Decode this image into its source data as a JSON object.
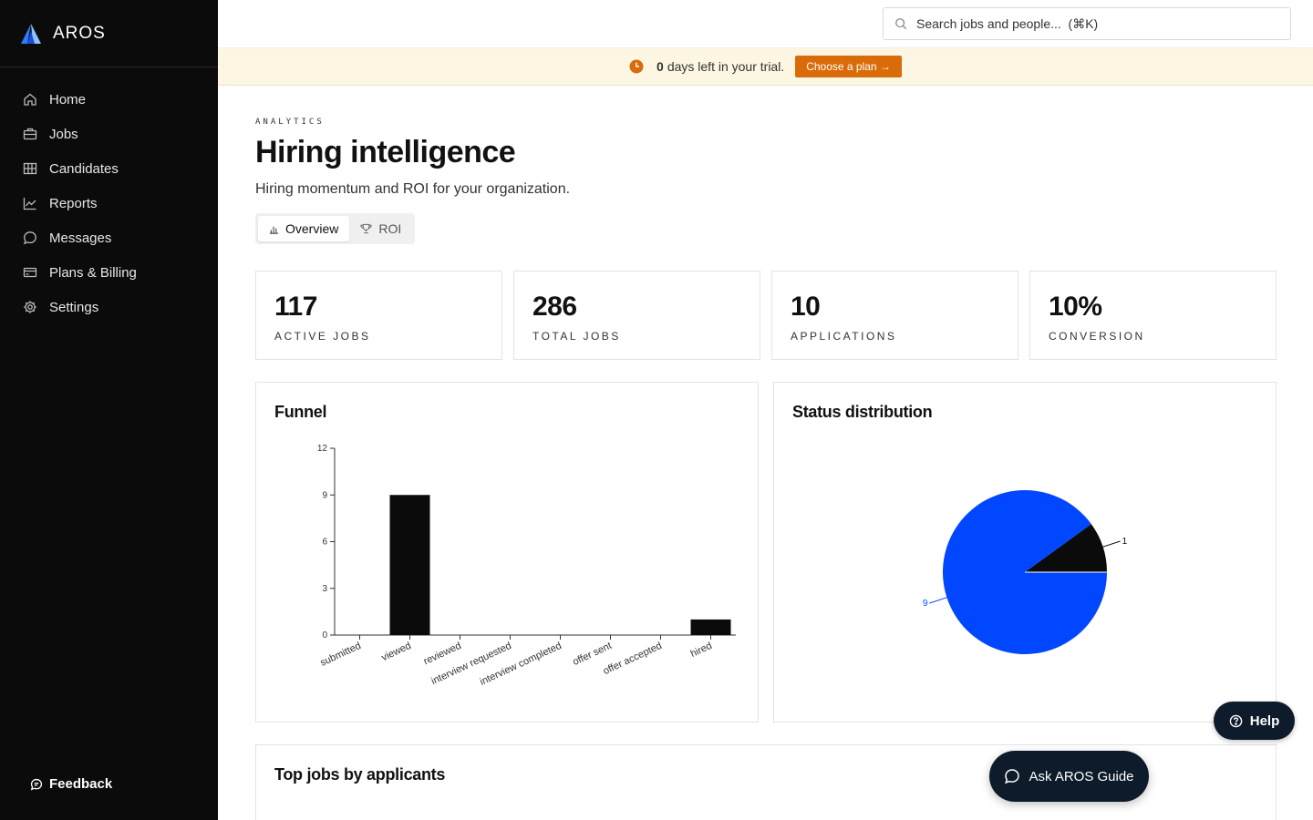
{
  "app": {
    "name": "AROS"
  },
  "sidebar": {
    "items": [
      {
        "label": "Home",
        "icon": "home-icon"
      },
      {
        "label": "Jobs",
        "icon": "briefcase-icon"
      },
      {
        "label": "Candidates",
        "icon": "candidates-icon"
      },
      {
        "label": "Reports",
        "icon": "chart-icon"
      },
      {
        "label": "Messages",
        "icon": "message-icon"
      },
      {
        "label": "Plans & Billing",
        "icon": "credit-card-icon"
      },
      {
        "label": "Settings",
        "icon": "gear-icon"
      }
    ],
    "feedback_label": "Feedback"
  },
  "search": {
    "placeholder": "Search jobs and people...  (⌘K)"
  },
  "trial": {
    "days": "0",
    "text": "days left in your trial.",
    "button": "Choose a plan →"
  },
  "page": {
    "eyebrow": "ANALYTICS",
    "title": "Hiring intelligence",
    "subtitle": "Hiring momentum and ROI for your organization.",
    "tabs": [
      {
        "label": "Overview"
      },
      {
        "label": "ROI"
      }
    ]
  },
  "kpis": [
    {
      "value": "117",
      "label": "ACTIVE JOBS"
    },
    {
      "value": "286",
      "label": "TOTAL JOBS"
    },
    {
      "value": "10",
      "label": "APPLICATIONS"
    },
    {
      "value": "10%",
      "label": "CONVERSION"
    }
  ],
  "cards": {
    "funnel_title": "Funnel",
    "status_title": "Status distribution",
    "top_jobs_title": "Top jobs by applicants"
  },
  "colors": {
    "accent": "#d96c09",
    "pie_primary": "#0047ff",
    "bar": "#0b0b0b",
    "dark_button": "#0d1b2a"
  },
  "chart_data": [
    {
      "type": "bar",
      "categories": [
        "submitted",
        "viewed",
        "reviewed",
        "interview requested",
        "interview completed",
        "offer sent",
        "offer accepted",
        "hired"
      ],
      "values": [
        0,
        9,
        0,
        0,
        0,
        0,
        0,
        1
      ],
      "yticks": [
        "0",
        "3",
        "6",
        "9",
        "12"
      ],
      "ylim": [
        0,
        12
      ]
    },
    {
      "type": "pie",
      "slices": [
        {
          "value": 9,
          "label": "9",
          "color": "#0047ff"
        },
        {
          "value": 1,
          "label": "1",
          "color": "#0b0b0b"
        }
      ]
    }
  ],
  "floating": {
    "help_label": "Help",
    "guide_label": "Ask AROS Guide"
  }
}
